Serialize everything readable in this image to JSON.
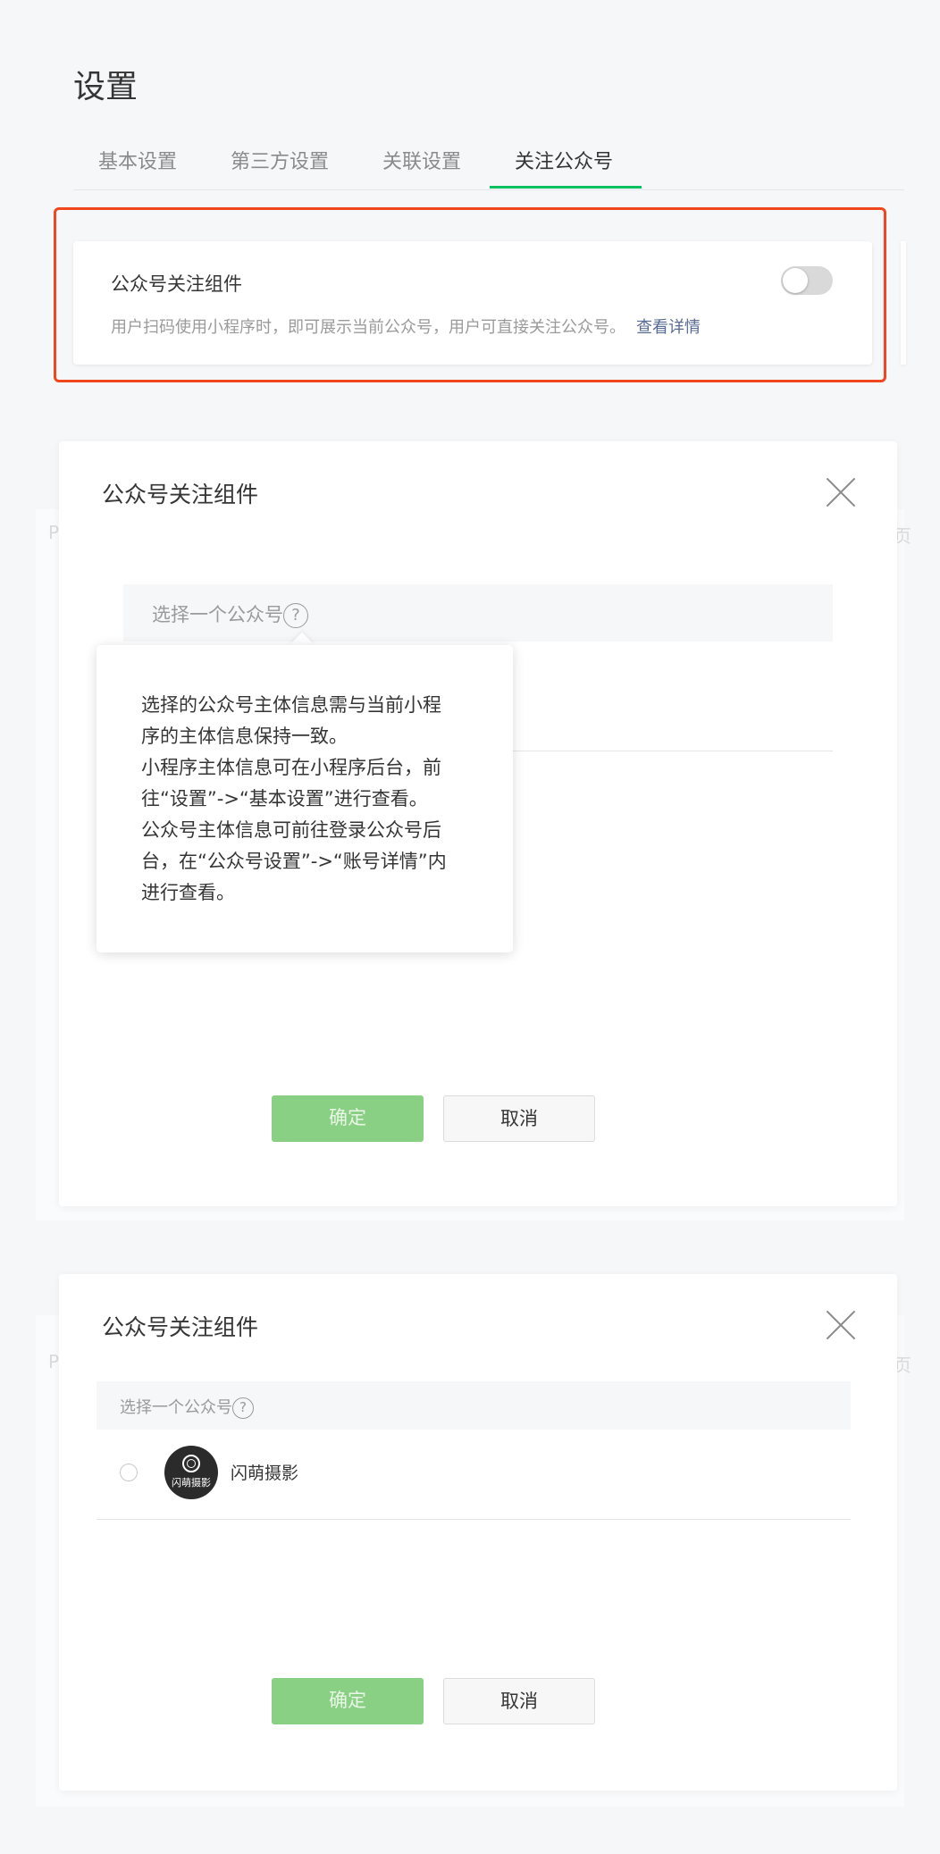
{
  "page": {
    "title": "设置"
  },
  "tabs": [
    {
      "label": "基本设置"
    },
    {
      "label": "第三方设置"
    },
    {
      "label": "关联设置"
    },
    {
      "label": "关注公众号"
    }
  ],
  "card": {
    "title": "公众号关注组件",
    "description": "用户扫码使用小程序时，即可展示当前公众号，用户可直接关注公众号。",
    "link": "查看详情",
    "toggle_on": false
  },
  "modal1": {
    "title": "公众号关注组件",
    "select_label": "选择一个公众号",
    "help_glyph": "?",
    "confirm": "确定",
    "cancel": "取消",
    "tooltip_lines": [
      "选择的公众号主体信息需与当前小程",
      "序的主体信息保持一致。",
      "小程序主体信息可在小程序后台，前",
      "往“设置”->“基本设置”进行查看。",
      "公众号主体信息可前往登录公众号后",
      "台，在“公众号设置”->“账号详情”内",
      "进行查看。"
    ]
  },
  "modal2": {
    "title": "公众号关注组件",
    "select_label": "选择一个公众号",
    "help_glyph": "?",
    "account": {
      "name": "闪萌摄影",
      "avatar_text": "闪萌摄影",
      "selected": false
    },
    "confirm": "确定",
    "cancel": "取消"
  },
  "background_fragments": {
    "left": "P",
    "right": "页"
  },
  "colors": {
    "accent": "#07c160",
    "highlight_border": "#f0471f",
    "link": "#576b95",
    "confirm_disabled": "#8ad084"
  }
}
